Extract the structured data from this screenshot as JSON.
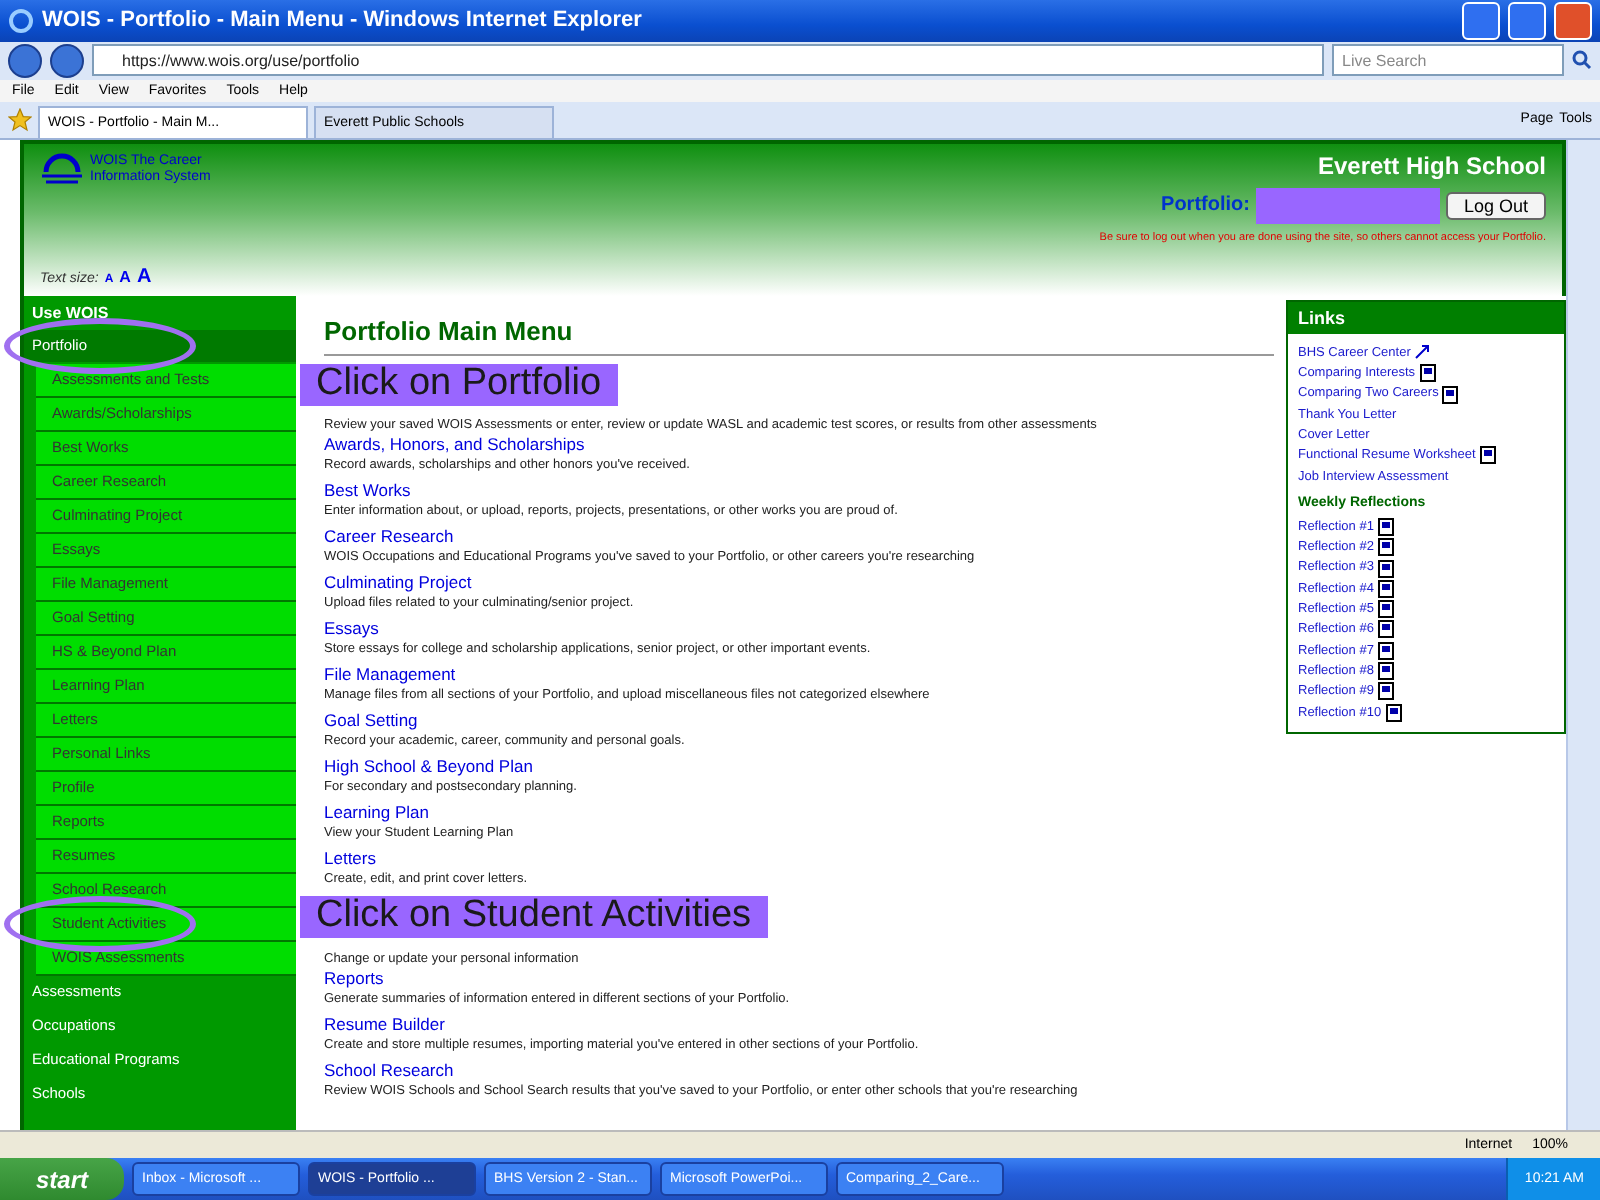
{
  "window": {
    "title": "WOIS - Portfolio - Main Menu - Windows Internet Explorer"
  },
  "address_bar": {
    "url": "https://www.wois.org/use/portfolio",
    "search_placeholder": "Live Search"
  },
  "menu_bar": [
    "File",
    "Edit",
    "View",
    "Favorites",
    "Tools",
    "Help"
  ],
  "tabs": [
    {
      "label": "WOIS - Portfolio - Main M...",
      "selected": true
    },
    {
      "label": "Everett Public Schools",
      "selected": false
    }
  ],
  "command_bar": [
    "Page",
    "Tools"
  ],
  "header": {
    "logo_line_1": "WOIS The Career",
    "logo_line_2": "Information System",
    "text_size_label": "Text size:",
    "text_sizes": [
      "A",
      "A",
      "A"
    ],
    "school": "Everett High School",
    "portfolio_label": "Portfolio:",
    "logout": "Log Out",
    "warning": "Be sure to log out when you are done using the site, so others cannot access your Portfolio."
  },
  "sidebar": {
    "title": "Use WOIS",
    "items": [
      {
        "label": "Portfolio",
        "kind": "section",
        "selected": true,
        "circled": true
      },
      {
        "label": "Assessments and Tests",
        "kind": "sub",
        "selected": false,
        "circled": false
      },
      {
        "label": "Awards/Scholarships",
        "kind": "sub",
        "selected": false,
        "circled": false
      },
      {
        "label": "Best Works",
        "kind": "sub",
        "selected": false,
        "circled": false
      },
      {
        "label": "Career Research",
        "kind": "sub",
        "selected": false,
        "circled": false
      },
      {
        "label": "Culminating Project",
        "kind": "sub",
        "selected": false,
        "circled": false
      },
      {
        "label": "Essays",
        "kind": "sub",
        "selected": false,
        "circled": false
      },
      {
        "label": "File Management",
        "kind": "sub",
        "selected": false,
        "circled": false
      },
      {
        "label": "Goal Setting",
        "kind": "sub",
        "selected": false,
        "circled": false
      },
      {
        "label": "HS & Beyond Plan",
        "kind": "sub",
        "selected": false,
        "circled": false
      },
      {
        "label": "Learning Plan",
        "kind": "sub",
        "selected": false,
        "circled": false
      },
      {
        "label": "Letters",
        "kind": "sub",
        "selected": false,
        "circled": false
      },
      {
        "label": "Personal Links",
        "kind": "sub",
        "selected": false,
        "circled": false
      },
      {
        "label": "Profile",
        "kind": "sub",
        "selected": false,
        "circled": false
      },
      {
        "label": "Reports",
        "kind": "sub",
        "selected": false,
        "circled": false
      },
      {
        "label": "Resumes",
        "kind": "sub",
        "selected": false,
        "circled": false
      },
      {
        "label": "School Research",
        "kind": "sub",
        "selected": false,
        "circled": false
      },
      {
        "label": "Student Activities",
        "kind": "sub",
        "selected": false,
        "circled": true
      },
      {
        "label": "WOIS Assessments",
        "kind": "sub",
        "selected": false,
        "circled": false
      },
      {
        "label": "Assessments",
        "kind": "section",
        "selected": false,
        "circled": false
      },
      {
        "label": "Occupations",
        "kind": "section",
        "selected": false,
        "circled": false
      },
      {
        "label": "Educational Programs",
        "kind": "section",
        "selected": false,
        "circled": false
      },
      {
        "label": "Schools",
        "kind": "section",
        "selected": false,
        "circled": false
      }
    ]
  },
  "main": {
    "title": "Portfolio Main Menu",
    "items": [
      {
        "description": "Review your saved WOIS Assessments or enter, review or update WASL and academic test scores, or results from other assessments"
      },
      {
        "title": "Awards, Honors, and Scholarships",
        "description": "Record awards, scholarships and other honors you've received."
      },
      {
        "title": "Best Works",
        "description": "Enter information about, or upload, reports, projects, presentations, or other works you are proud of."
      },
      {
        "title": "Career Research",
        "description": "WOIS Occupations and Educational Programs you've saved to your Portfolio, or other careers you're researching"
      },
      {
        "title": "Culminating Project",
        "description": "Upload files related to your culminating/senior project."
      },
      {
        "title": "Essays",
        "description": "Store essays for college and scholarship applications, senior project, or other important events."
      },
      {
        "title": "File Management",
        "description": "Manage files from all sections of your Portfolio, and upload miscellaneous files not categorized elsewhere"
      },
      {
        "title": "Goal Setting",
        "description": "Record your academic, career, community and personal goals."
      },
      {
        "title": "High School & Beyond Plan",
        "description": "For secondary and postsecondary planning."
      },
      {
        "title": "Learning Plan",
        "description": "View your Student Learning Plan"
      },
      {
        "title": "Letters",
        "description": "Create, edit, and print cover letters."
      },
      {
        "description": "Change or update your personal information"
      },
      {
        "title": "Reports",
        "description": "Generate summaries of information entered in different sections of your Portfolio."
      },
      {
        "title": "Resume Builder",
        "description": "Create and store multiple resumes, importing material you've entered in other sections of your Portfolio."
      },
      {
        "title": "School Research",
        "description": "Review WOIS Schools and School Search results that you've saved to your Portfolio, or enter other schools that you're researching"
      }
    ]
  },
  "callouts": [
    "Click on Portfolio",
    "Click on Student Activities"
  ],
  "links": {
    "title": "Links",
    "items": [
      {
        "label": "BHS Career Center",
        "kind": "external"
      },
      {
        "label": "Comparing Interests",
        "kind": "document"
      },
      {
        "label": "Comparing Two Careers",
        "kind": "document"
      },
      {
        "label": "Thank You Letter",
        "kind": "plain"
      },
      {
        "label": "Cover Letter",
        "kind": "plain"
      },
      {
        "label": "Functional Resume Worksheet",
        "kind": "document"
      },
      {
        "label": "Job Interview Assessment",
        "kind": "plain"
      }
    ],
    "section": "Weekly Reflections",
    "reflections": [
      "Reflection #1",
      "Reflection #2",
      "Reflection #3",
      "Reflection #4",
      "Reflection #5",
      "Reflection #6",
      "Reflection #7",
      "Reflection #8",
      "Reflection #9",
      "Reflection #10"
    ]
  },
  "status_bar": {
    "zone": "Internet",
    "zoom": "100%"
  },
  "taskbar": {
    "start": "start",
    "tasks": [
      {
        "label": "Inbox - Microsoft ...",
        "selected": false
      },
      {
        "label": "WOIS - Portfolio ...",
        "selected": true
      },
      {
        "label": "BHS Version 2 - Stan...",
        "selected": false
      },
      {
        "label": "Microsoft PowerPoi...",
        "selected": false
      },
      {
        "label": "Comparing_2_Care...",
        "selected": false
      }
    ],
    "time": "10:21 AM"
  }
}
